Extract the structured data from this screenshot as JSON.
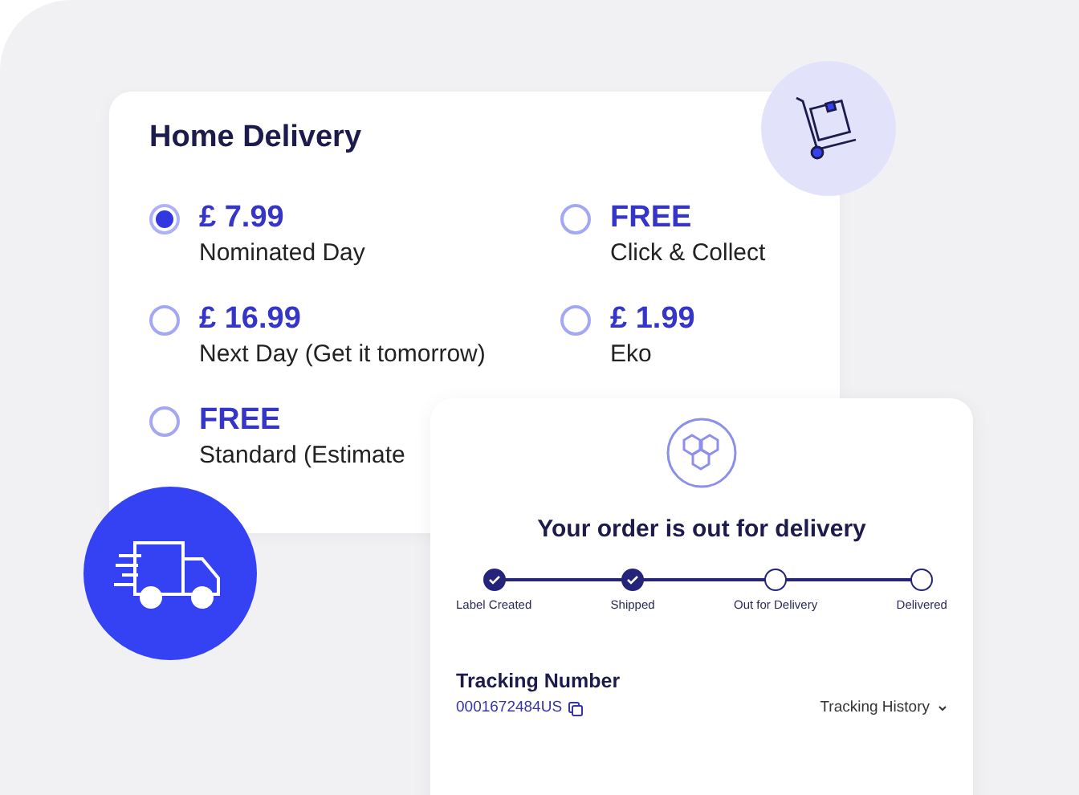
{
  "delivery": {
    "title": "Home Delivery",
    "options": [
      {
        "price": "£ 7.99",
        "label": "Nominated Day",
        "selected": true
      },
      {
        "price": "FREE",
        "label": "Click & Collect",
        "selected": false
      },
      {
        "price": "£ 16.99",
        "label": "Next Day (Get it tomorrow)",
        "selected": false
      },
      {
        "price": "£ 1.99",
        "label": "Eko",
        "selected": false
      },
      {
        "price": "FREE",
        "label": "Standard (Estimate",
        "selected": false
      }
    ]
  },
  "tracking": {
    "title": "Your order is out for delivery",
    "steps": [
      {
        "label": "Label Created",
        "done": true
      },
      {
        "label": "Shipped",
        "done": true
      },
      {
        "label": "Out for Delivery",
        "done": false
      },
      {
        "label": "Delivered",
        "done": false
      }
    ],
    "number_label": "Tracking Number",
    "number": "0001672484US",
    "history_link": "Tracking History"
  }
}
